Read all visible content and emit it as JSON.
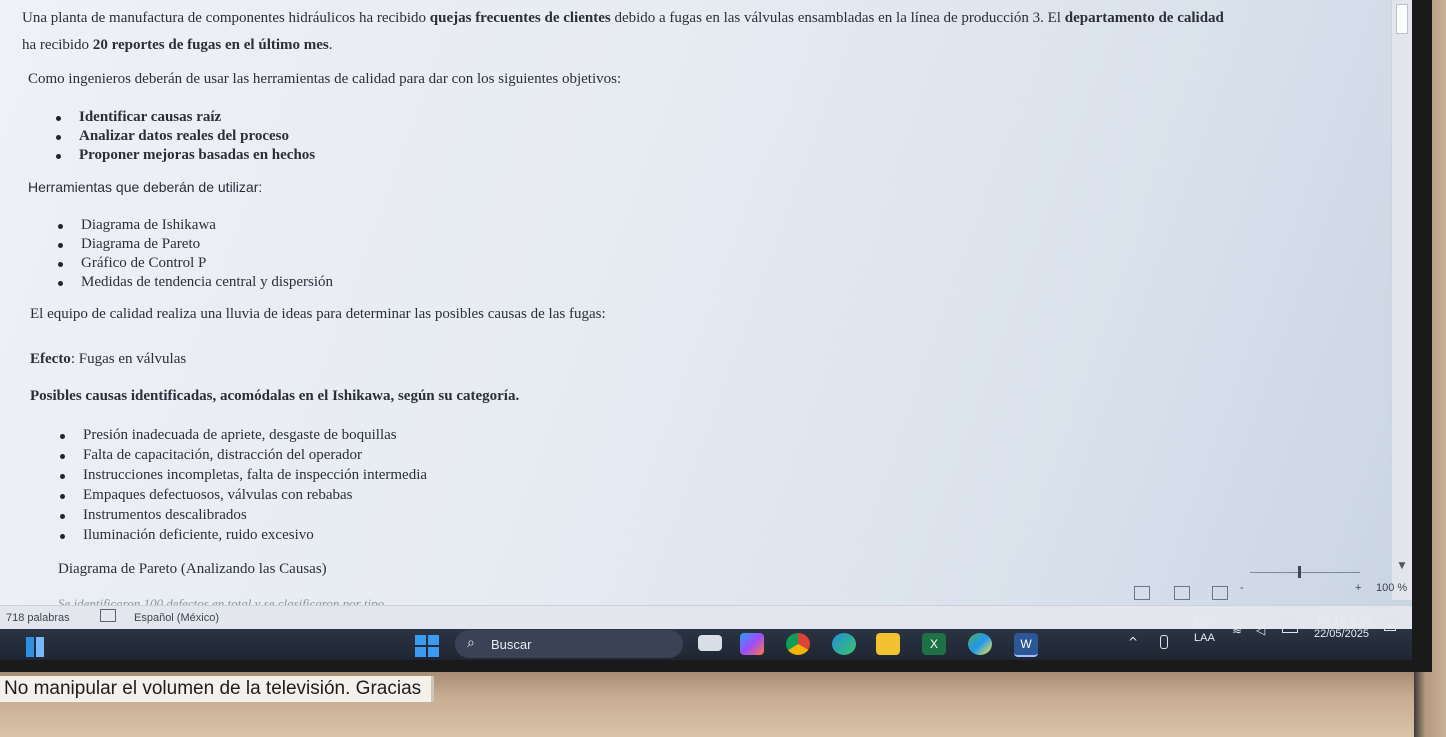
{
  "document": {
    "intro_line1_a": "Una planta de manufactura de componentes hidráulicos ha recibido ",
    "intro_line1_b": "quejas frecuentes de clientes",
    "intro_line1_c": " debido a fugas en las válvulas ensambladas en la línea de producción 3. El ",
    "intro_line1_d": "departamento de calidad",
    "intro_line2_a": "ha recibido ",
    "intro_line2_b": "20 reportes de fugas en el último mes",
    "intro_line2_c": ".",
    "objectives_intro": "Como ingenieros deberán de usar las herramientas de calidad para dar con los siguientes objetivos:",
    "objectives": [
      "Identificar causas raíz",
      "Analizar datos reales del proceso",
      "Proponer mejoras basadas en hechos"
    ],
    "tools_heading": "Herramientas que deberán de utilizar:",
    "tools": [
      "Diagrama de Ishikawa",
      "Diagrama de Pareto",
      "Gráfico de Control P",
      "Medidas de tendencia central y dispersión"
    ],
    "brainstorm": "El equipo de calidad realiza una lluvia de ideas para determinar las posibles causas de las fugas:",
    "effect_label": "Efecto",
    "effect_value": ": Fugas en válvulas",
    "causes_heading": "Posibles causas identificadas, acomódalas en el Ishikawa, según su categoría.",
    "causes": [
      "Presión inadecuada de apriete, desgaste de boquillas",
      "Falta de capacitación, distracción del operador",
      "Instrucciones incompletas, falta de inspección intermedia",
      "Empaques defectuosos, válvulas con rebabas",
      "Instrumentos descalibrados",
      "Iluminación deficiente, ruido excesivo"
    ],
    "pareto_heading": "Diagrama de Pareto (Analizando las Causas)",
    "faded_line": "Se identificaron 100 defectos en total y se clasificaron por tipo"
  },
  "statusbar": {
    "word_count": "718 palabras",
    "language": "Español (México)",
    "zoom": "100 %",
    "zoom_minus": "-",
    "zoom_plus": "+"
  },
  "taskbar": {
    "search_label": "Buscar",
    "lang_top": "ESP",
    "lang_bottom": "LAA",
    "time": "09:16 a. m.",
    "date": "22/05/2025"
  },
  "sticker": {
    "text": "No manipular el volumen de la televisión. Gracias"
  },
  "colors": {
    "text": "#2a2f3a",
    "taskbar": "#1f2633",
    "word_icon": "#2b5797",
    "excel_icon": "#1e7145",
    "edge_icon": "#1f8fd8",
    "chrome_red": "#db4437"
  }
}
